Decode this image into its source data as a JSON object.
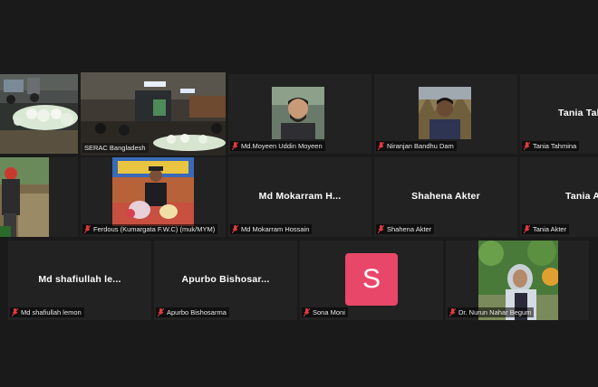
{
  "participants": [
    {
      "display_name": "",
      "caption": "",
      "kind": "video-room"
    },
    {
      "display_name": "",
      "caption": "SERAC Bangladesh",
      "kind": "video-conference"
    },
    {
      "display_name": "",
      "caption": "Md.Moyeen Uddin Moyeen",
      "kind": "photo"
    },
    {
      "display_name": "",
      "caption": "Niranjan Bandhu Dam",
      "kind": "photo"
    },
    {
      "display_name": "Tania Tah",
      "caption": "Tania Tahmina",
      "kind": "name"
    },
    {
      "display_name": "",
      "caption": "",
      "kind": "video-outdoor"
    },
    {
      "display_name": "",
      "caption": "Ferdous (Kumargata F.W.C) (muk/MYM)",
      "kind": "photo"
    },
    {
      "display_name": "Md Mokarram H...",
      "caption": "Md Mokarram Hossain",
      "kind": "name"
    },
    {
      "display_name": "Shahena Akter",
      "caption": "Shahena Akter",
      "kind": "name"
    },
    {
      "display_name": "Tania A",
      "caption": "Tania Akter",
      "kind": "name"
    },
    {
      "display_name": "Md shafiullah le...",
      "caption": "Md shafiullah lemon",
      "kind": "name"
    },
    {
      "display_name": "Apurbo Bishosar...",
      "caption": "Apurbo Bishosarma",
      "kind": "name"
    },
    {
      "display_name": "",
      "caption": "Sona Moni",
      "kind": "avatar",
      "avatar_letter": "S",
      "avatar_color": "#e94769"
    },
    {
      "display_name": "",
      "caption": "Dr. Nurun Nahar Begum",
      "kind": "photo"
    }
  ],
  "colors": {
    "background": "#1a1a1a",
    "tile": "#222222",
    "active_speaker_border": "#c6e04a",
    "muted_icon": "#e0383e"
  },
  "icons": {
    "muted": "mic-muted-icon"
  }
}
